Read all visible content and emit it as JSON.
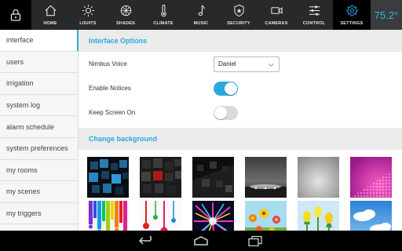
{
  "topbar": {
    "items": [
      {
        "label": "HOME",
        "icon": "house-icon"
      },
      {
        "label": "LIGHTS",
        "icon": "sun-icon"
      },
      {
        "label": "SHADES",
        "icon": "shades-icon"
      },
      {
        "label": "CLIMATE",
        "icon": "thermometer-icon"
      },
      {
        "label": "MUSIC",
        "icon": "music-note-icon"
      },
      {
        "label": "SECURITY",
        "icon": "shield-icon"
      },
      {
        "label": "CAMERAS",
        "icon": "camera-icon"
      },
      {
        "label": "CONTROL",
        "icon": "sliders-icon"
      },
      {
        "label": "SETTINGS",
        "icon": "gear-icon"
      }
    ],
    "active": "SETTINGS",
    "temperature": "75.2°"
  },
  "sidebar": {
    "items": [
      {
        "label": "interface"
      },
      {
        "label": "users"
      },
      {
        "label": "irrigation"
      },
      {
        "label": "system log"
      },
      {
        "label": "alarm schedule"
      },
      {
        "label": "system preferences"
      },
      {
        "label": "my rooms"
      },
      {
        "label": "my scenes"
      },
      {
        "label": "my triggers"
      }
    ],
    "active": "interface"
  },
  "interface_options": {
    "title": "Interface Options",
    "voice_label": "Nimbus Voice",
    "voice_value": "Daniel",
    "notices_label": "Enable Notices",
    "notices_on": true,
    "screen_label": "Keep Screen On",
    "screen_on": false
  },
  "background": {
    "title": "Change background",
    "thumbnails": [
      "dark-blue-cubes",
      "red-black-cubes",
      "dark-gray-cubes",
      "gray-spotlight-floor",
      "silver-gradient",
      "pink-dots",
      "rainbow-paint-drips",
      "paint-drops-white",
      "neon-splash",
      "colorful-flowers",
      "yellow-tulips",
      "blue-sky-clouds"
    ]
  },
  "colors": {
    "accent": "#2aa8e0",
    "topbar": "#27292b"
  }
}
